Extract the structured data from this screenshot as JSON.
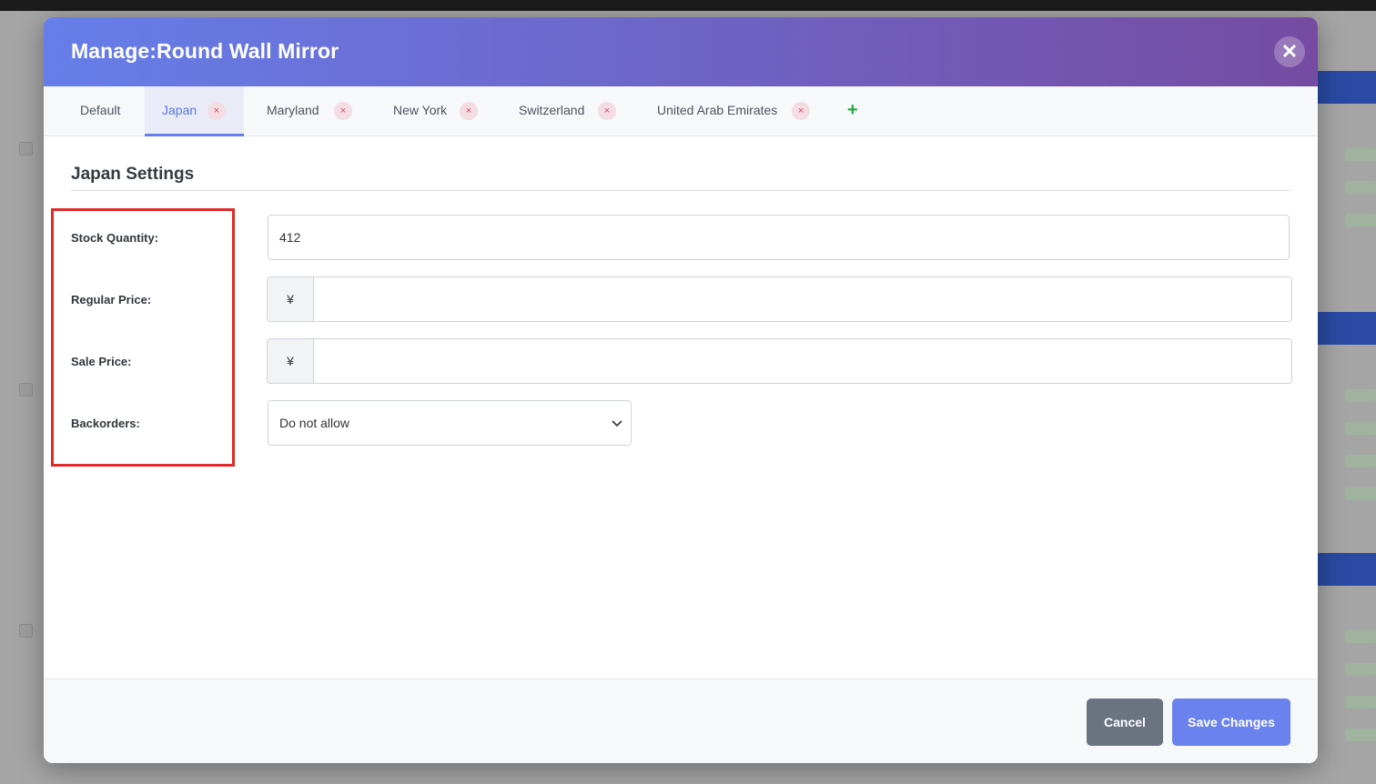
{
  "modal": {
    "title": "Manage:Round Wall Mirror",
    "close_label": "✕"
  },
  "tabs": [
    {
      "label": "Default",
      "removable": false,
      "active": false
    },
    {
      "label": "Japan",
      "removable": true,
      "active": true
    },
    {
      "label": "Maryland",
      "removable": true,
      "active": false
    },
    {
      "label": "New York",
      "removable": true,
      "active": false
    },
    {
      "label": "Switzerland",
      "removable": true,
      "active": false
    },
    {
      "label": "United Arab Emirates",
      "removable": true,
      "active": false
    }
  ],
  "tab_remove_glyph": "×",
  "tab_add_glyph": "+",
  "section": {
    "title": "Japan Settings"
  },
  "fields": {
    "stock_quantity": {
      "label": "Stock Quantity:",
      "value": "412"
    },
    "regular_price": {
      "label": "Regular Price:",
      "currency": "¥",
      "value": ""
    },
    "sale_price": {
      "label": "Sale Price:",
      "currency": "¥",
      "value": ""
    },
    "backorders": {
      "label": "Backorders:",
      "selected": "Do not allow"
    }
  },
  "footer": {
    "cancel_label": "Cancel",
    "save_label": "Save Changes"
  },
  "colors": {
    "header_gradient_start": "#667eea",
    "header_gradient_end": "#764ba2",
    "accent": "#667eea",
    "highlight": "#e02a2a",
    "add_green": "#28a745",
    "remove_red": "#d9455f"
  }
}
